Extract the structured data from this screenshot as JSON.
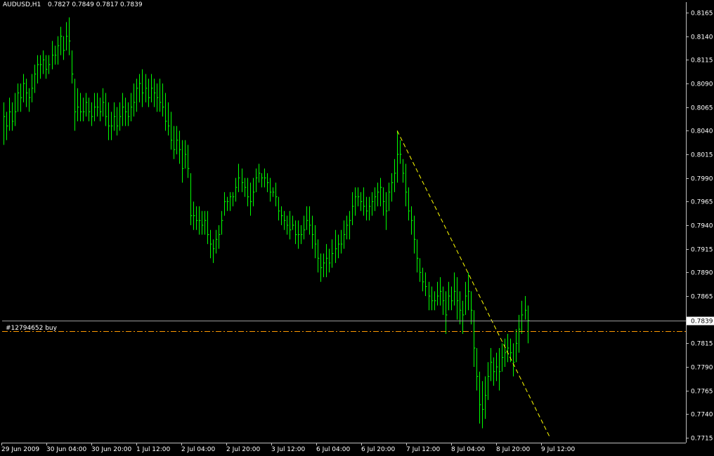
{
  "window": {
    "title": "AUDUSD,H1",
    "ohlc": "0.7827 0.7849 0.7817 0.7839"
  },
  "colors": {
    "background": "#000000",
    "bars": "#00ff00",
    "axis": "#c0c0c0",
    "trendline": "#ffff00",
    "order_line": "#ff9900",
    "price_line": "#9a9a9a",
    "price_label_bg": "#ffffff",
    "price_label_text": "#000000"
  },
  "order": {
    "label": "#12794652 buy",
    "price": 0.7828
  },
  "current_price": {
    "label": "0.7839",
    "value": 0.7839
  },
  "chart_data": {
    "type": "ohlc",
    "symbol": "AUDUSD",
    "timeframe": "H1",
    "y_ticks": [
      "0.8165",
      "0.8140",
      "0.8115",
      "0.8090",
      "0.8065",
      "0.8040",
      "0.8015",
      "0.7990",
      "0.7965",
      "0.7940",
      "0.7915",
      "0.7890",
      "0.7865",
      "0.7815",
      "0.7790",
      "0.7765",
      "0.7740",
      "0.7715"
    ],
    "x_ticks": [
      "29 Jun 2009",
      "30 Jun 04:00",
      "30 Jun 20:00",
      "1 Jul 12:00",
      "2 Jul 04:00",
      "2 Jul 20:00",
      "3 Jul 12:00",
      "6 Jul 04:00",
      "6 Jul 20:00",
      "7 Jul 12:00",
      "8 Jul 04:00",
      "8 Jul 20:00",
      "9 Jul 12:00"
    ],
    "ylim": [
      0.771,
      0.8175
    ],
    "bars_hlc": [
      [
        0.807,
        0.8025,
        0.8055
      ],
      [
        0.806,
        0.803,
        0.8045
      ],
      [
        0.8075,
        0.804,
        0.806
      ],
      [
        0.807,
        0.804,
        0.805
      ],
      [
        0.808,
        0.8045,
        0.806
      ],
      [
        0.809,
        0.806,
        0.808
      ],
      [
        0.809,
        0.806,
        0.8075
      ],
      [
        0.81,
        0.807,
        0.809
      ],
      [
        0.8095,
        0.8065,
        0.808
      ],
      [
        0.8085,
        0.806,
        0.8075
      ],
      [
        0.81,
        0.807,
        0.8085
      ],
      [
        0.811,
        0.808,
        0.81
      ],
      [
        0.812,
        0.809,
        0.811
      ],
      [
        0.812,
        0.8095,
        0.811
      ],
      [
        0.8125,
        0.81,
        0.8115
      ],
      [
        0.812,
        0.8095,
        0.8105
      ],
      [
        0.812,
        0.81,
        0.811
      ],
      [
        0.8135,
        0.8105,
        0.812
      ],
      [
        0.813,
        0.811,
        0.812
      ],
      [
        0.814,
        0.811,
        0.813
      ],
      [
        0.815,
        0.812,
        0.814
      ],
      [
        0.814,
        0.8115,
        0.8125
      ],
      [
        0.8155,
        0.8125,
        0.814
      ],
      [
        0.816,
        0.812,
        0.8135
      ],
      [
        0.8125,
        0.809,
        0.81
      ],
      [
        0.8095,
        0.804,
        0.806
      ],
      [
        0.8085,
        0.805,
        0.8065
      ],
      [
        0.808,
        0.805,
        0.806
      ],
      [
        0.8075,
        0.805,
        0.806
      ],
      [
        0.808,
        0.8055,
        0.807
      ],
      [
        0.8075,
        0.805,
        0.806
      ],
      [
        0.807,
        0.8045,
        0.8055
      ],
      [
        0.808,
        0.805,
        0.8065
      ],
      [
        0.808,
        0.8055,
        0.8065
      ],
      [
        0.8075,
        0.805,
        0.806
      ],
      [
        0.8085,
        0.8055,
        0.807
      ],
      [
        0.808,
        0.8045,
        0.8055
      ],
      [
        0.807,
        0.803,
        0.8045
      ],
      [
        0.806,
        0.803,
        0.8045
      ],
      [
        0.807,
        0.804,
        0.8055
      ],
      [
        0.8065,
        0.8035,
        0.8045
      ],
      [
        0.807,
        0.804,
        0.8055
      ],
      [
        0.808,
        0.8045,
        0.8065
      ],
      [
        0.8075,
        0.8045,
        0.806
      ],
      [
        0.807,
        0.8045,
        0.8055
      ],
      [
        0.808,
        0.805,
        0.8065
      ],
      [
        0.809,
        0.8055,
        0.807
      ],
      [
        0.8095,
        0.806,
        0.8085
      ],
      [
        0.81,
        0.807,
        0.809
      ],
      [
        0.8105,
        0.8065,
        0.808
      ],
      [
        0.81,
        0.807,
        0.8085
      ],
      [
        0.8095,
        0.8065,
        0.8075
      ],
      [
        0.81,
        0.807,
        0.8085
      ],
      [
        0.8095,
        0.8065,
        0.808
      ],
      [
        0.809,
        0.806,
        0.8075
      ],
      [
        0.8095,
        0.806,
        0.807
      ],
      [
        0.809,
        0.8055,
        0.8065
      ],
      [
        0.808,
        0.804,
        0.805
      ],
      [
        0.807,
        0.8035,
        0.8045
      ],
      [
        0.806,
        0.802,
        0.803
      ],
      [
        0.8045,
        0.801,
        0.802
      ],
      [
        0.8045,
        0.8015,
        0.803
      ],
      [
        0.804,
        0.8005,
        0.802
      ],
      [
        0.803,
        0.7985,
        0.8
      ],
      [
        0.803,
        0.8,
        0.8015
      ],
      [
        0.8025,
        0.799,
        0.8
      ],
      [
        0.7995,
        0.794,
        0.795
      ],
      [
        0.7965,
        0.7935,
        0.795
      ],
      [
        0.796,
        0.7935,
        0.7945
      ],
      [
        0.796,
        0.793,
        0.7945
      ],
      [
        0.7955,
        0.793,
        0.794
      ],
      [
        0.7955,
        0.793,
        0.7945
      ],
      [
        0.7955,
        0.792,
        0.793
      ],
      [
        0.7935,
        0.7905,
        0.792
      ],
      [
        0.7925,
        0.79,
        0.7915
      ],
      [
        0.7935,
        0.791,
        0.7925
      ],
      [
        0.794,
        0.7915,
        0.793
      ],
      [
        0.7955,
        0.793,
        0.7945
      ],
      [
        0.7975,
        0.795,
        0.7965
      ],
      [
        0.797,
        0.7955,
        0.7965
      ],
      [
        0.7975,
        0.7955,
        0.797
      ],
      [
        0.7975,
        0.796,
        0.797
      ],
      [
        0.799,
        0.7965,
        0.798
      ],
      [
        0.8005,
        0.7975,
        0.799
      ],
      [
        0.8,
        0.7975,
        0.7985
      ],
      [
        0.799,
        0.797,
        0.798
      ],
      [
        0.799,
        0.796,
        0.797
      ],
      [
        0.7985,
        0.795,
        0.7965
      ],
      [
        0.799,
        0.796,
        0.7975
      ],
      [
        0.8,
        0.7975,
        0.799
      ],
      [
        0.8005,
        0.7985,
        0.7995
      ],
      [
        0.7995,
        0.798,
        0.799
      ],
      [
        0.8,
        0.798,
        0.799
      ],
      [
        0.7995,
        0.7975,
        0.7985
      ],
      [
        0.799,
        0.7965,
        0.7975
      ],
      [
        0.798,
        0.797,
        0.7975
      ],
      [
        0.7985,
        0.796,
        0.797
      ],
      [
        0.797,
        0.7945,
        0.7955
      ],
      [
        0.796,
        0.794,
        0.795
      ],
      [
        0.7955,
        0.7935,
        0.7945
      ],
      [
        0.795,
        0.793,
        0.794
      ],
      [
        0.7955,
        0.7925,
        0.7935
      ],
      [
        0.795,
        0.7935,
        0.794
      ],
      [
        0.7945,
        0.792,
        0.793
      ],
      [
        0.7945,
        0.7915,
        0.793
      ],
      [
        0.794,
        0.792,
        0.793
      ],
      [
        0.795,
        0.7925,
        0.7935
      ],
      [
        0.796,
        0.7935,
        0.7945
      ],
      [
        0.796,
        0.793,
        0.794
      ],
      [
        0.795,
        0.7915,
        0.793
      ],
      [
        0.794,
        0.7905,
        0.792
      ],
      [
        0.7925,
        0.789,
        0.7905
      ],
      [
        0.791,
        0.788,
        0.7895
      ],
      [
        0.791,
        0.7885,
        0.79
      ],
      [
        0.792,
        0.7885,
        0.7905
      ],
      [
        0.7915,
        0.789,
        0.79
      ],
      [
        0.7925,
        0.7895,
        0.791
      ],
      [
        0.7935,
        0.79,
        0.7915
      ],
      [
        0.793,
        0.7905,
        0.792
      ],
      [
        0.7935,
        0.791,
        0.792
      ],
      [
        0.7945,
        0.7915,
        0.793
      ],
      [
        0.795,
        0.7925,
        0.794
      ],
      [
        0.7955,
        0.7925,
        0.7945
      ],
      [
        0.7975,
        0.794,
        0.796
      ],
      [
        0.798,
        0.795,
        0.797
      ],
      [
        0.798,
        0.796,
        0.797
      ],
      [
        0.7975,
        0.7955,
        0.7965
      ],
      [
        0.798,
        0.795,
        0.796
      ],
      [
        0.797,
        0.7945,
        0.7955
      ],
      [
        0.797,
        0.7945,
        0.796
      ],
      [
        0.7975,
        0.795,
        0.7965
      ],
      [
        0.798,
        0.7955,
        0.797
      ],
      [
        0.7985,
        0.796,
        0.7975
      ],
      [
        0.799,
        0.796,
        0.798
      ],
      [
        0.798,
        0.795,
        0.7965
      ],
      [
        0.7975,
        0.7935,
        0.7955
      ],
      [
        0.7985,
        0.7955,
        0.7975
      ],
      [
        0.7995,
        0.7965,
        0.7985
      ],
      [
        0.801,
        0.7975,
        0.7995
      ],
      [
        0.804,
        0.7985,
        0.8015
      ],
      [
        0.803,
        0.8005,
        0.8015
      ],
      [
        0.801,
        0.7985,
        0.7995
      ],
      [
        0.8005,
        0.796,
        0.7975
      ],
      [
        0.798,
        0.7945,
        0.7955
      ],
      [
        0.796,
        0.793,
        0.7945
      ],
      [
        0.795,
        0.791,
        0.7925
      ],
      [
        0.7925,
        0.789,
        0.7905
      ],
      [
        0.7905,
        0.788,
        0.789
      ],
      [
        0.7895,
        0.787,
        0.788
      ],
      [
        0.789,
        0.7865,
        0.7875
      ],
      [
        0.788,
        0.785,
        0.7865
      ],
      [
        0.7875,
        0.785,
        0.786
      ],
      [
        0.787,
        0.785,
        0.786
      ],
      [
        0.788,
        0.7855,
        0.7865
      ],
      [
        0.7885,
        0.7855,
        0.787
      ],
      [
        0.7875,
        0.7845,
        0.786
      ],
      [
        0.787,
        0.7825,
        0.7845
      ],
      [
        0.788,
        0.785,
        0.7865
      ],
      [
        0.7875,
        0.785,
        0.786
      ],
      [
        0.789,
        0.7855,
        0.787
      ],
      [
        0.7885,
        0.784,
        0.786
      ],
      [
        0.787,
        0.7835,
        0.785
      ],
      [
        0.786,
        0.7825,
        0.7845
      ],
      [
        0.788,
        0.7845,
        0.7865
      ],
      [
        0.789,
        0.785,
        0.787
      ],
      [
        0.787,
        0.7835,
        0.785
      ],
      [
        0.785,
        0.779,
        0.781
      ],
      [
        0.781,
        0.7765,
        0.778
      ],
      [
        0.7785,
        0.773,
        0.775
      ],
      [
        0.7775,
        0.7725,
        0.7745
      ],
      [
        0.778,
        0.7735,
        0.776
      ],
      [
        0.7795,
        0.7755,
        0.778
      ],
      [
        0.781,
        0.7775,
        0.7795
      ],
      [
        0.78,
        0.777,
        0.7785
      ],
      [
        0.7805,
        0.7775,
        0.779
      ],
      [
        0.781,
        0.7765,
        0.7785
      ],
      [
        0.7815,
        0.7785,
        0.78
      ],
      [
        0.782,
        0.779,
        0.7805
      ],
      [
        0.7825,
        0.7795,
        0.781
      ],
      [
        0.782,
        0.7795,
        0.7805
      ],
      [
        0.7815,
        0.778,
        0.7795
      ],
      [
        0.783,
        0.7795,
        0.7815
      ],
      [
        0.7845,
        0.7805,
        0.783
      ],
      [
        0.786,
        0.7825,
        0.7845
      ],
      [
        0.7865,
        0.784,
        0.785
      ],
      [
        0.7855,
        0.7815,
        0.7839
      ]
    ],
    "trendline": {
      "from": [
        139,
        0.804
      ],
      "to": [
        193,
        0.7715
      ]
    }
  }
}
